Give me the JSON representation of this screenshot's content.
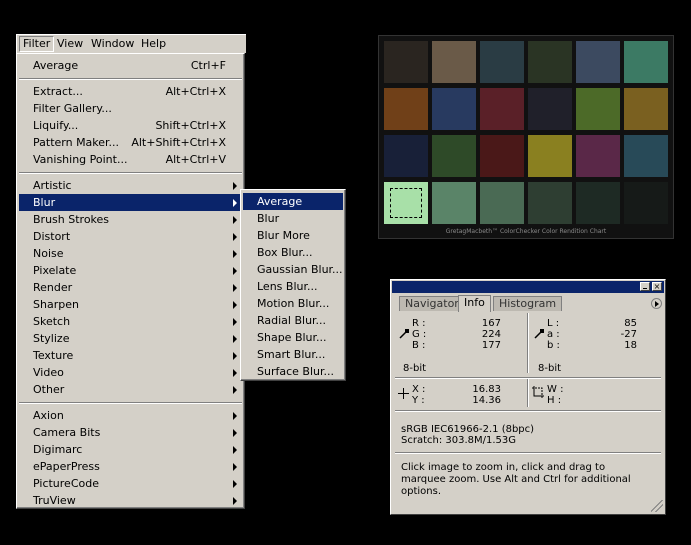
{
  "menubar": {
    "items": [
      {
        "label": "Filter"
      },
      {
        "label": "View"
      },
      {
        "label": "Window"
      },
      {
        "label": "Help"
      }
    ]
  },
  "filter_menu": {
    "groups": [
      [
        {
          "label": "Average",
          "shortcut": "Ctrl+F"
        }
      ],
      [
        {
          "label": "Extract...",
          "shortcut": "Alt+Ctrl+X"
        },
        {
          "label": "Filter Gallery...",
          "shortcut": ""
        },
        {
          "label": "Liquify...",
          "shortcut": "Shift+Ctrl+X"
        },
        {
          "label": "Pattern Maker...",
          "shortcut": "Alt+Shift+Ctrl+X"
        },
        {
          "label": "Vanishing Point...",
          "shortcut": "Alt+Ctrl+V"
        }
      ],
      [
        {
          "label": "Artistic",
          "submenu": true
        },
        {
          "label": "Blur",
          "submenu": true,
          "highlighted": true
        },
        {
          "label": "Brush Strokes",
          "submenu": true
        },
        {
          "label": "Distort",
          "submenu": true
        },
        {
          "label": "Noise",
          "submenu": true
        },
        {
          "label": "Pixelate",
          "submenu": true
        },
        {
          "label": "Render",
          "submenu": true
        },
        {
          "label": "Sharpen",
          "submenu": true
        },
        {
          "label": "Sketch",
          "submenu": true
        },
        {
          "label": "Stylize",
          "submenu": true
        },
        {
          "label": "Texture",
          "submenu": true
        },
        {
          "label": "Video",
          "submenu": true
        },
        {
          "label": "Other",
          "submenu": true
        }
      ],
      [
        {
          "label": "Axion",
          "submenu": true
        },
        {
          "label": "Camera Bits",
          "submenu": true
        },
        {
          "label": "Digimarc",
          "submenu": true
        },
        {
          "label": "ePaperPress",
          "submenu": true
        },
        {
          "label": "PictureCode",
          "submenu": true
        },
        {
          "label": "TruView",
          "submenu": true
        }
      ]
    ]
  },
  "blur_submenu": {
    "items": [
      {
        "label": "Average",
        "highlighted": true
      },
      {
        "label": "Blur"
      },
      {
        "label": "Blur More"
      },
      {
        "label": "Box Blur..."
      },
      {
        "label": "Gaussian Blur..."
      },
      {
        "label": "Lens Blur..."
      },
      {
        "label": "Motion Blur..."
      },
      {
        "label": "Radial Blur..."
      },
      {
        "label": "Shape Blur..."
      },
      {
        "label": "Smart Blur..."
      },
      {
        "label": "Surface Blur..."
      }
    ]
  },
  "color_checker": {
    "caption": "GretagMacbeth™ ColorChecker Color Rendition Chart",
    "swatches": [
      "#2a2520",
      "#6a5a48",
      "#2a3c44",
      "#2a3424",
      "#3c4a60",
      "#3c7a64",
      "#704018",
      "#283a60",
      "#5a2028",
      "#20202a",
      "#4c6a28",
      "#7a6020",
      "#182038",
      "#2e4a28",
      "#4a1818",
      "#8a8020",
      "#5a2848",
      "#284a58",
      "#a8e0a8",
      "#5a8468",
      "#4a6a54",
      "#2e3e32",
      "#1e2a24",
      "#161a18"
    ],
    "selected_swatch_color": "#a8e0a8"
  },
  "info_panel": {
    "tabs": [
      "Navigator",
      "Info",
      "Histogram"
    ],
    "active_tab": "Info",
    "rgb": {
      "r_label": "R :",
      "g_label": "G :",
      "b_label": "B :",
      "r": "167",
      "g": "224",
      "b": "177"
    },
    "lab": {
      "l_label": "L :",
      "a_label": "a :",
      "b_label": "b :",
      "l": "85",
      "a": "-27",
      "b": "18"
    },
    "bit_left": "8-bit",
    "bit_right": "8-bit",
    "pos": {
      "x_label": "X :",
      "y_label": "Y :",
      "x": "16.83",
      "y": "14.36"
    },
    "size": {
      "w_label": "W :",
      "h_label": "H :"
    },
    "profile": "sRGB IEC61966-2.1 (8bpc)",
    "scratch": "Scratch: 303.8M/1.53G",
    "hint": "Click image to zoom in, click and drag to marquee zoom.  Use Alt and Ctrl for additional options."
  }
}
